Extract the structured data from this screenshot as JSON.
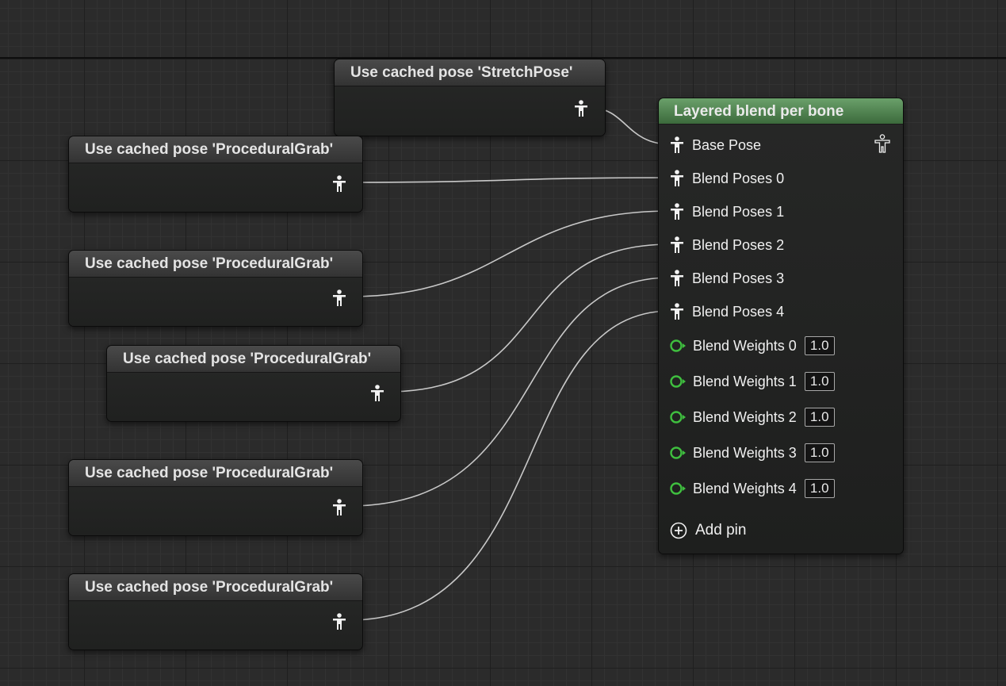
{
  "cached_nodes": [
    {
      "title": "Use cached pose 'StretchPose'"
    },
    {
      "title": "Use cached pose 'ProceduralGrab'"
    },
    {
      "title": "Use cached pose 'ProceduralGrab'"
    },
    {
      "title": "Use cached pose 'ProceduralGrab'"
    },
    {
      "title": "Use cached pose 'ProceduralGrab'"
    },
    {
      "title": "Use cached pose 'ProceduralGrab'"
    }
  ],
  "blend_node": {
    "title": "Layered blend per bone",
    "header_color": "#5b8f5b",
    "pose_pins": [
      "Base Pose",
      "Blend Poses 0",
      "Blend Poses 1",
      "Blend Poses 2",
      "Blend Poses 3",
      "Blend Poses 4"
    ],
    "weight_pins": [
      {
        "label": "Blend Weights 0",
        "value": "1.0"
      },
      {
        "label": "Blend Weights 1",
        "value": "1.0"
      },
      {
        "label": "Blend Weights 2",
        "value": "1.0"
      },
      {
        "label": "Blend Weights 3",
        "value": "1.0"
      },
      {
        "label": "Blend Weights 4",
        "value": "1.0"
      }
    ],
    "add_pin_label": "Add pin"
  },
  "colors": {
    "float_pin": "#3fbf3f",
    "wire": "#c8c8c8"
  },
  "icons": {
    "pose_pin": "pose-pin-icon",
    "float_pin": "float-pin-icon",
    "add": "add-pin-icon",
    "pose_output": "pose-output-icon"
  }
}
